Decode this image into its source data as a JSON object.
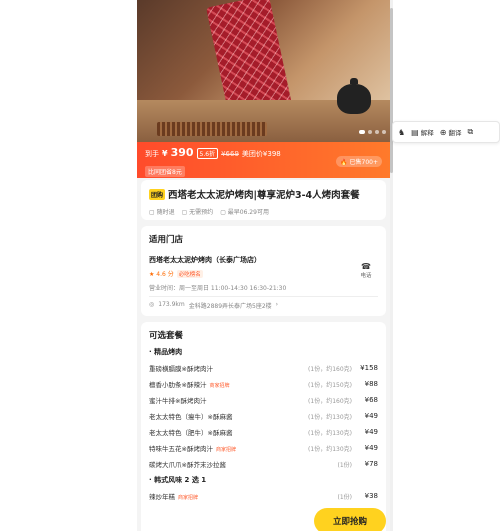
{
  "hero": {
    "dots": 4
  },
  "price": {
    "prefix": "到手",
    "yen": "¥",
    "amount": "390",
    "discount": "5.6折",
    "original": "¥669",
    "group_price": "美团价¥398",
    "limited": "比同团省8元",
    "sold": "🔥 已售700+"
  },
  "deal": {
    "tag": "团购",
    "title": "西塔老太太泥炉烤肉|尊享泥炉3-4人烤肉套餐",
    "features": [
      "随时退",
      "无需预约",
      "最早06.29可用"
    ]
  },
  "store": {
    "section_title": "适用门店",
    "name": "西塔老太太泥炉烤肉（长泰广场店）",
    "score": "★ 4.6 分",
    "rank": "必吃榜名",
    "hours": "营业时间：周一至周日 11:00-14:30 16:30-21:30",
    "phone_label": "电话",
    "distance": "173.9km",
    "address": "金科路2889弄长泰广场5座2楼",
    "address_arrow": "›"
  },
  "menu": {
    "section_title": "可选套餐",
    "categories": [
      {
        "name": "精品烤肉",
        "items": [
          {
            "name": "重磅横膈膜※酥烤肉汁",
            "badge": "",
            "qty": "(1份，约160克)",
            "price": "¥158"
          },
          {
            "name": "檀香小肋条※酥辣汁",
            "badge": "商家招牌",
            "qty": "(1份，约150克)",
            "price": "¥88"
          },
          {
            "name": "蜜汁牛排※酥烤肉汁",
            "badge": "",
            "qty": "(1份，约160克)",
            "price": "¥68"
          },
          {
            "name": "老太太特色（瘦牛）※酥麻酱",
            "badge": "",
            "qty": "(1份，约130克)",
            "price": "¥49"
          },
          {
            "name": "老太太特色（肥牛）※酥麻酱",
            "badge": "",
            "qty": "(1份，约130克)",
            "price": "¥49"
          },
          {
            "name": "特味牛五花※酥烤肉汁",
            "badge": "商家招牌",
            "qty": "(1份，约130克)",
            "price": "¥49"
          },
          {
            "name": "碳烤大爪爪※酥芥末沙拉酱",
            "badge": "",
            "qty": "(1份)",
            "price": "¥78"
          }
        ]
      },
      {
        "name": "韩式风味 2 选 1",
        "items": [
          {
            "name": "辣炒年糕",
            "badge": "商家招牌",
            "qty": "(1份)",
            "price": "¥38"
          }
        ]
      }
    ]
  },
  "buy_button": "立即抢购",
  "toolbar": {
    "explain": "解释",
    "translate": "翻译"
  }
}
